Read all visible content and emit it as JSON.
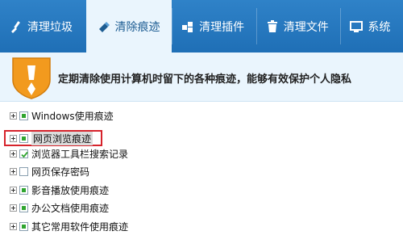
{
  "tabs": [
    {
      "label": "清理垃圾",
      "icon": "broom-icon"
    },
    {
      "label": "清除痕迹",
      "icon": "eraser-icon",
      "active": true
    },
    {
      "label": "清理插件",
      "icon": "puzzle-icon"
    },
    {
      "label": "清理文件",
      "icon": "trash-icon"
    },
    {
      "label": "系统",
      "icon": "monitor-icon"
    }
  ],
  "banner": {
    "description": "定期清除使用计算机时留下的各种痕迹，能够有效保护个人隐私"
  },
  "tree": {
    "items": [
      {
        "label": "Windows使用痕迹",
        "check_state": "partial"
      },
      {
        "label": "网页浏览痕迹",
        "check_state": "partial"
      },
      {
        "label": "浏览器工具栏搜索记录",
        "check_state": "checked"
      },
      {
        "label": "网页保存密码",
        "check_state": "unchecked"
      },
      {
        "label": "影音播放使用痕迹",
        "check_state": "partial"
      },
      {
        "label": "办公文档使用痕迹",
        "check_state": "partial"
      },
      {
        "label": "其它常用软件使用痕迹",
        "check_state": "partial"
      }
    ]
  },
  "colors": {
    "tab_bar": "#2a7bc2",
    "active_tab_bg": "#eaf5fd",
    "shield_orange": "#f29a1e",
    "checkbox_green": "#2fa52f",
    "highlight_red": "#d6232b"
  }
}
